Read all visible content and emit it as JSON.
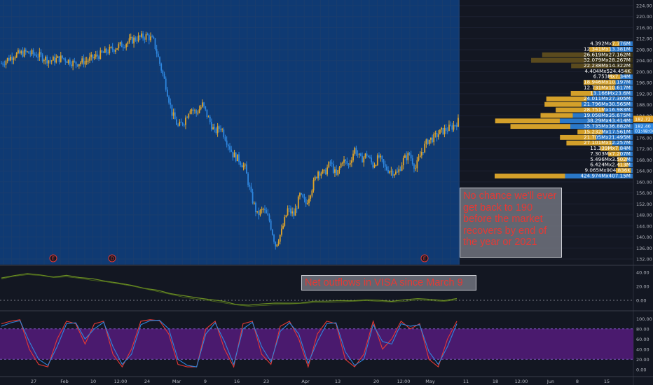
{
  "chart_data": [
    {
      "type": "candlestick",
      "ylim": [
        132,
        224
      ],
      "y_ticks": [
        132,
        136,
        140,
        144,
        148,
        152,
        156,
        160,
        164,
        168,
        172,
        176,
        180,
        184,
        188,
        192,
        196,
        200,
        204,
        208,
        212,
        216,
        220,
        224
      ],
      "y_tick_labels": [
        "132.00",
        "136.00",
        "140.00",
        "144.00",
        "148.00",
        "152.00",
        "156.00",
        "160.00",
        "164.00",
        "168.00",
        "172.00",
        "176.00",
        "180.00",
        "184.00",
        "188.00",
        "192.00",
        "196.00",
        "200.00",
        "204.00",
        "208.00",
        "212.00",
        "216.00",
        "220.00",
        "224.00"
      ],
      "x_tick_labels": [
        "27",
        "Feb",
        "10",
        "12:00",
        "24",
        "Mar",
        "9",
        "16",
        "23",
        "Apr",
        "13",
        "20",
        "12:00",
        "May",
        "11",
        "18",
        "12:00",
        "Jun",
        "8",
        "15"
      ],
      "price_path": [
        [
          0,
          203
        ],
        [
          4,
          206
        ],
        [
          8,
          207
        ],
        [
          12,
          206
        ],
        [
          16,
          204
        ],
        [
          20,
          205
        ],
        [
          24,
          203
        ],
        [
          28,
          204
        ],
        [
          32,
          206
        ],
        [
          36,
          208
        ],
        [
          40,
          210
        ],
        [
          44,
          212
        ],
        [
          48,
          213
        ],
        [
          50,
          211
        ],
        [
          52,
          203
        ],
        [
          54,
          195
        ],
        [
          56,
          185
        ],
        [
          58,
          180
        ],
        [
          60,
          182
        ],
        [
          62,
          187
        ],
        [
          64,
          185
        ],
        [
          66,
          188
        ],
        [
          68,
          183
        ],
        [
          70,
          178
        ],
        [
          72,
          180
        ],
        [
          74,
          175
        ],
        [
          76,
          170
        ],
        [
          78,
          168
        ],
        [
          80,
          165
        ],
        [
          82,
          155
        ],
        [
          84,
          148
        ],
        [
          86,
          150
        ],
        [
          88,
          146
        ],
        [
          90,
          137
        ],
        [
          92,
          142
        ],
        [
          94,
          150
        ],
        [
          96,
          148
        ],
        [
          98,
          155
        ],
        [
          100,
          152
        ],
        [
          102,
          158
        ],
        [
          104,
          164
        ],
        [
          106,
          163
        ],
        [
          108,
          167
        ],
        [
          110,
          162
        ],
        [
          112,
          168
        ],
        [
          114,
          166
        ],
        [
          116,
          172
        ],
        [
          118,
          168
        ],
        [
          120,
          170
        ],
        [
          122,
          166
        ],
        [
          124,
          169
        ],
        [
          126,
          165
        ],
        [
          128,
          164
        ],
        [
          130,
          163
        ],
        [
          132,
          168
        ],
        [
          134,
          170
        ],
        [
          136,
          165
        ],
        [
          138,
          171
        ],
        [
          140,
          175
        ],
        [
          142,
          176
        ],
        [
          144,
          178
        ],
        [
          146,
          179
        ],
        [
          148,
          180
        ],
        [
          150,
          182
        ]
      ],
      "last_price": "182.72",
      "last_price_sub": "182.40",
      "countdown": "01:48:06",
      "earnings_markers": [
        "E",
        "D",
        "E"
      ],
      "volume_profile": [
        {
          "price": 210,
          "label": "4.392Mx7.776M",
          "up": 0.36,
          "down": 0.64,
          "volume": 12.17
        },
        {
          "price": 208,
          "label": "12.341Mx13.381M",
          "up": 0.48,
          "down": 0.52,
          "volume": 25.72
        },
        {
          "price": 206,
          "label": "26.619Mx27.162M",
          "up": 0.49,
          "down": 0.51,
          "volume": 53.78
        },
        {
          "price": 204,
          "label": "32.079Mx28.267M",
          "up": 0.53,
          "down": 0.47,
          "volume": 60.35
        },
        {
          "price": 202,
          "label": "22.238Mx14.322M",
          "up": 0.61,
          "down": 0.39,
          "volume": 36.56
        },
        {
          "price": 200,
          "label": "4.404Mx524.454K",
          "up": 0.89,
          "down": 0.11,
          "volume": 4.93
        },
        {
          "price": 198,
          "label": "6.753Mx7.34M",
          "up": 0.48,
          "down": 0.52,
          "volume": 14.09
        },
        {
          "price": 196,
          "label": "18.946Mx10.197M",
          "up": 0.65,
          "down": 0.35,
          "volume": 29.14
        },
        {
          "price": 194,
          "label": "12.731Mx10.617M",
          "up": 0.55,
          "down": 0.45,
          "volume": 23.35
        },
        {
          "price": 192,
          "label": "13.166Mx23.6M",
          "up": 0.36,
          "down": 0.64,
          "volume": 36.77
        },
        {
          "price": 190,
          "label": "24.011Mx27.305M",
          "up": 0.47,
          "down": 0.53,
          "volume": 51.32
        },
        {
          "price": 188,
          "label": "21.796Mx30.565M",
          "up": 0.42,
          "down": 0.58,
          "volume": 52.36
        },
        {
          "price": 186,
          "label": "28.751Mx16.983M",
          "up": 0.63,
          "down": 0.37,
          "volume": 45.73
        },
        {
          "price": 184,
          "label": "19.058Mx35.675M",
          "up": 0.35,
          "down": 0.65,
          "volume": 54.73
        },
        {
          "price": 182,
          "label": "38.29Mx43.414M",
          "up": 0.47,
          "down": 0.53,
          "volume": 81.7
        },
        {
          "price": 180,
          "label": "35.735Mx36.882M",
          "up": 0.49,
          "down": 0.51,
          "volume": 72.62
        },
        {
          "price": 178,
          "label": "15.232Mx17.561M",
          "up": 0.46,
          "down": 0.54,
          "volume": 32.79
        },
        {
          "price": 176,
          "label": "21.705Mx21.495M",
          "up": 0.5,
          "down": 0.5,
          "volume": 43.2
        },
        {
          "price": 174,
          "label": "27.101Mx12.257M",
          "up": 0.69,
          "down": 0.31,
          "volume": 39.36
        },
        {
          "price": 172,
          "label": "11.339Mx7.84M",
          "up": 0.59,
          "down": 0.41,
          "volume": 19.18
        },
        {
          "price": 170,
          "label": "7.303Mx7.207M",
          "up": 0.5,
          "down": 0.5,
          "volume": 14.51
        },
        {
          "price": 168,
          "label": "5.496Mx3.502M",
          "up": 0.61,
          "down": 0.39,
          "volume": 9.0
        },
        {
          "price": 166,
          "label": "6.424Mx2.413M",
          "up": 0.73,
          "down": 0.27,
          "volume": 8.84
        },
        {
          "price": 164,
          "label": "9.065Mx904.836K",
          "up": 0.91,
          "down": 0.09,
          "volume": 9.97
        },
        {
          "price": 162,
          "label": "424.974Mx407.15M",
          "up": 0.51,
          "down": 0.49,
          "volume": 832.1
        }
      ],
      "colors": {
        "background": "#131722",
        "grid": "#1a3d6e",
        "highlight": "#0f3a73",
        "up_candle": "#e0a42a",
        "down_candle": "#2e86de",
        "vp_up": "#d4a02a",
        "vp_down": "#2a78c9"
      }
    },
    {
      "type": "line",
      "ylim": [
        -10,
        45
      ],
      "y_ticks": [
        0,
        20,
        40
      ],
      "y_tick_labels": [
        "0.00",
        "20.00",
        "40.00"
      ],
      "series": [
        {
          "color": "#6b8e23",
          "values": [
            32,
            36,
            38,
            37,
            34,
            35,
            33,
            30,
            28,
            25,
            22,
            18,
            14,
            10,
            6,
            3,
            1,
            -2,
            -5,
            -7,
            -6,
            -5,
            -4,
            -3,
            -2,
            -2,
            -1,
            0,
            1,
            0,
            -1,
            0,
            2,
            1,
            0,
            2
          ]
        }
      ],
      "reference_line": 0
    },
    {
      "type": "line",
      "ylim": [
        -10,
        110
      ],
      "y_ticks": [
        0,
        20,
        40,
        60,
        80,
        100
      ],
      "y_tick_labels": [
        "0.00",
        "20.00",
        "40.00",
        "60.00",
        "80.00",
        "100.00"
      ],
      "band": [
        20,
        80
      ],
      "series": [
        {
          "color": "#e53935",
          "values": [
            90,
            95,
            98,
            40,
            10,
            5,
            60,
            95,
            90,
            50,
            90,
            95,
            30,
            5,
            40,
            95,
            98,
            96,
            70,
            10,
            5,
            5,
            80,
            95,
            40,
            5,
            90,
            95,
            30,
            10,
            85,
            95,
            60,
            5,
            70,
            95,
            90,
            20,
            5,
            30,
            95,
            40,
            60,
            95,
            80,
            90,
            20,
            5,
            60,
            95
          ]
        },
        {
          "color": "#2e86de",
          "values": [
            85,
            92,
            96,
            55,
            20,
            8,
            45,
            90,
            92,
            60,
            80,
            93,
            45,
            10,
            30,
            88,
            96,
            97,
            80,
            20,
            8,
            5,
            70,
            92,
            55,
            10,
            80,
            93,
            45,
            15,
            75,
            92,
            70,
            12,
            55,
            90,
            92,
            35,
            8,
            20,
            88,
            55,
            50,
            90,
            85,
            88,
            35,
            10,
            45,
            90
          ]
        }
      ]
    }
  ],
  "annotations": {
    "main_note": "No chance we'll ever get back to 190 before the market recovers by end of the year or 2021",
    "flow_note": "Net outflows in VISA since March 9"
  }
}
